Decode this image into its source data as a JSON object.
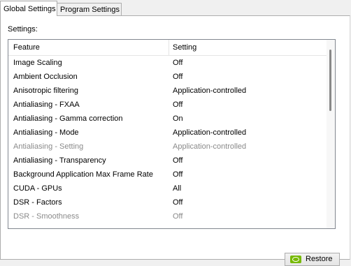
{
  "tabs": [
    {
      "label": "Global Settings",
      "active": true
    },
    {
      "label": "Program Settings",
      "active": false
    }
  ],
  "panel": {
    "settings_label": "Settings:",
    "columns": {
      "feature": "Feature",
      "setting": "Setting"
    },
    "rows": [
      {
        "feature": "Image Scaling",
        "setting": "Off",
        "disabled": false
      },
      {
        "feature": "Ambient Occlusion",
        "setting": "Off",
        "disabled": false
      },
      {
        "feature": "Anisotropic filtering",
        "setting": "Application-controlled",
        "disabled": false
      },
      {
        "feature": "Antialiasing - FXAA",
        "setting": "Off",
        "disabled": false
      },
      {
        "feature": "Antialiasing - Gamma correction",
        "setting": "On",
        "disabled": false
      },
      {
        "feature": "Antialiasing - Mode",
        "setting": "Application-controlled",
        "disabled": false
      },
      {
        "feature": "Antialiasing - Setting",
        "setting": "Application-controlled",
        "disabled": true
      },
      {
        "feature": "Antialiasing - Transparency",
        "setting": "Off",
        "disabled": false
      },
      {
        "feature": "Background Application Max Frame Rate",
        "setting": "Off",
        "disabled": false
      },
      {
        "feature": "CUDA - GPUs",
        "setting": "All",
        "disabled": false
      },
      {
        "feature": "DSR - Factors",
        "setting": "Off",
        "disabled": false
      },
      {
        "feature": "DSR - Smoothness",
        "setting": "Off",
        "disabled": true
      }
    ],
    "restore_label": "Restore"
  },
  "colors": {
    "accent": "#76b900",
    "disabled_text": "#8a8a8a"
  }
}
